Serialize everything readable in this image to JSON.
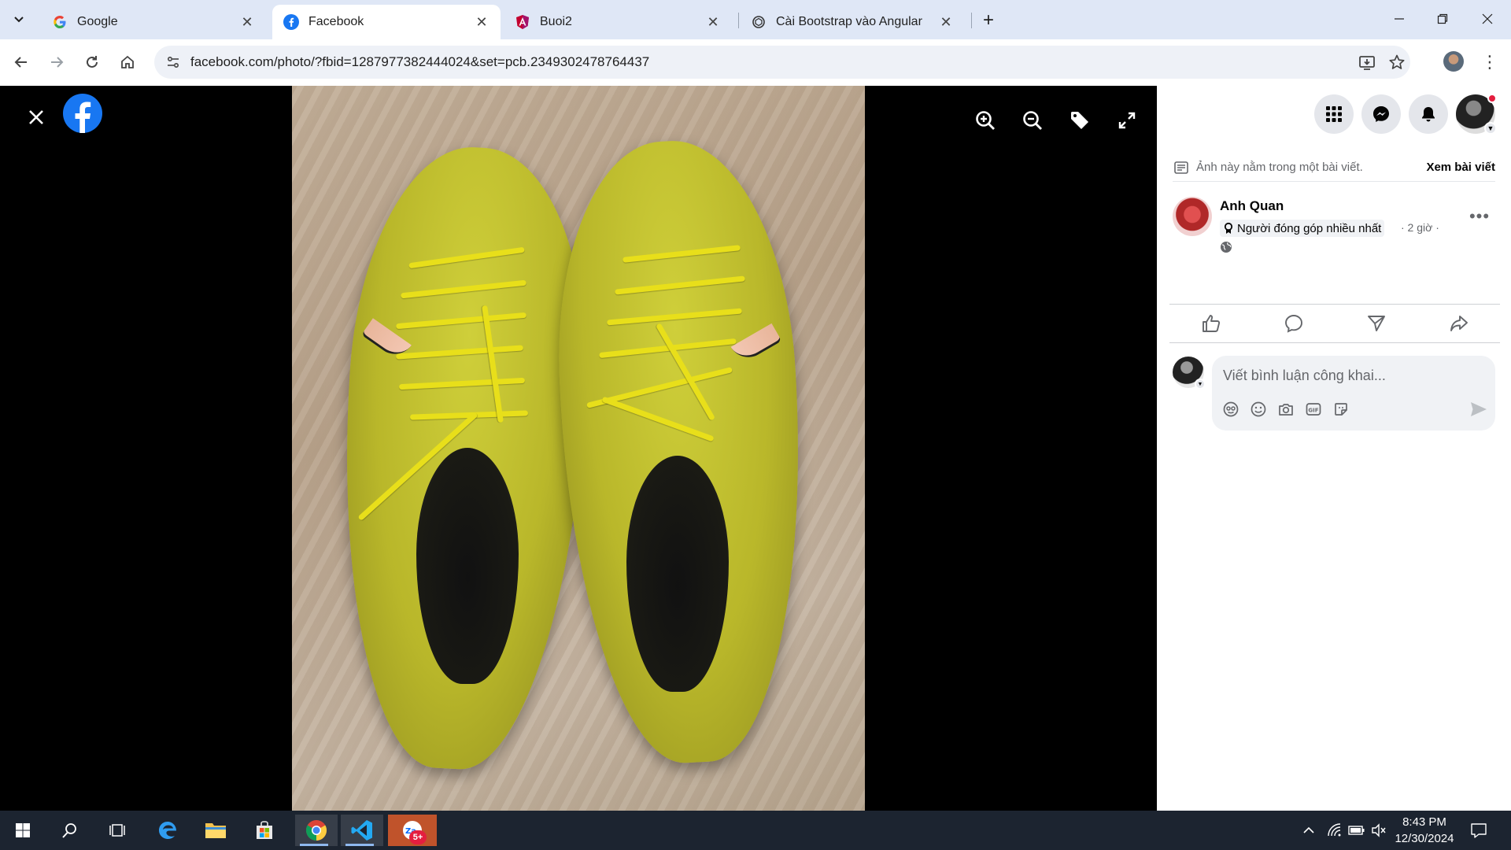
{
  "browser": {
    "tabs": [
      {
        "title": "Google",
        "icon": "google-icon",
        "active": false
      },
      {
        "title": "Facebook",
        "icon": "facebook-icon",
        "active": true
      },
      {
        "title": "Buoi2",
        "icon": "angular-icon",
        "active": false
      },
      {
        "title": "Cài Bootstrap vào Angular",
        "icon": "chatgpt-icon",
        "active": false
      }
    ],
    "url": "facebook.com/photo/?fbid=1287977382444024&set=pcb.2349302478764437"
  },
  "post": {
    "note_text": "Ảnh này nằm trong một bài viết.",
    "note_link": "Xem bài viết",
    "author_name": "Anh Quan",
    "badge_text": "Người đóng góp nhiều nhất",
    "time": "· 2 giờ ·"
  },
  "comment": {
    "placeholder": "Viết bình luận công khai..."
  },
  "taskbar": {
    "time": "8:43 PM",
    "date": "12/30/2024",
    "zalo_badge": "5+"
  },
  "colors": {
    "facebook_blue": "#1877f2",
    "notif_red": "#e41e3f",
    "taskbar": "#1c2430",
    "tabstrip": "#dfe7f6"
  }
}
